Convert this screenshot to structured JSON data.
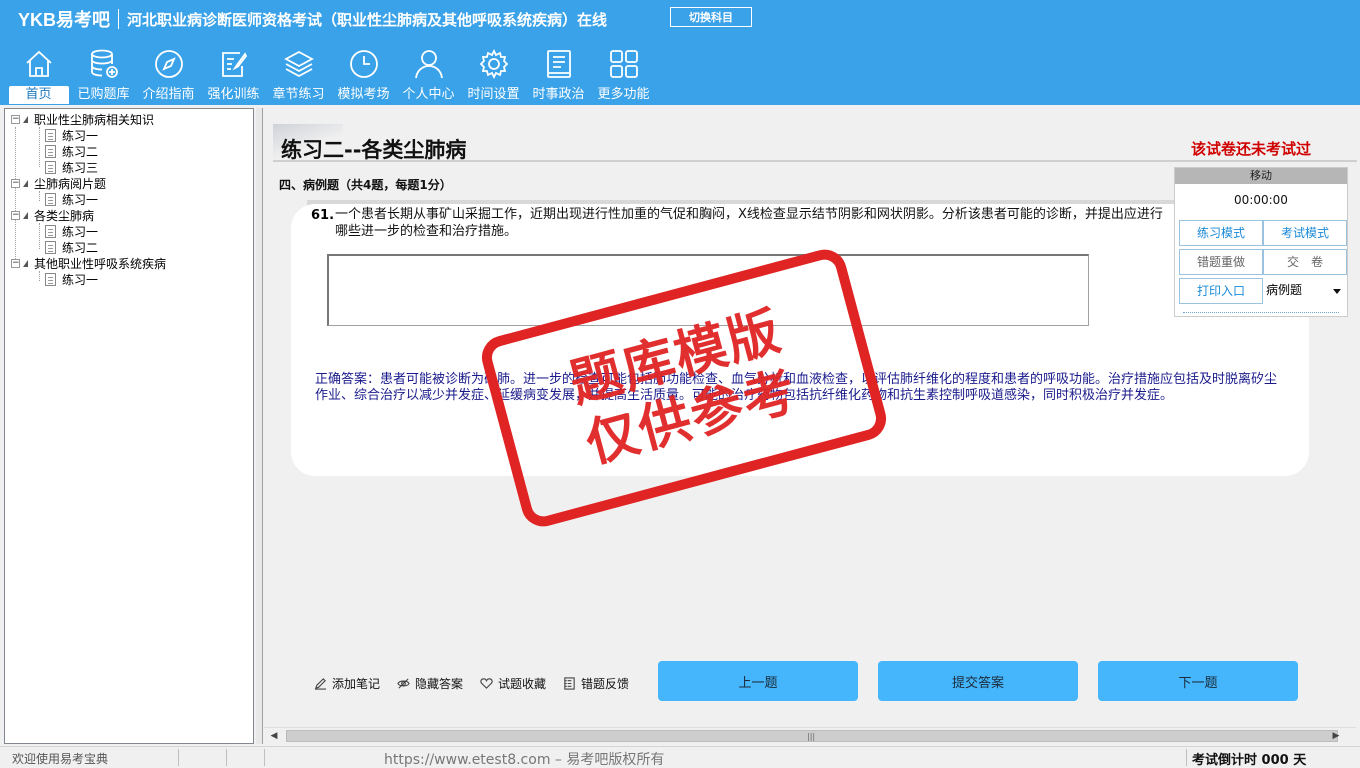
{
  "header": {
    "logo": "YKB易考吧",
    "title": "河北职业病诊断医师资格考试（职业性尘肺病及其他呼吸系统疾病）在线",
    "switch_label": "切换科目",
    "nav": [
      {
        "label": "首页",
        "icon": "home-icon",
        "active": true
      },
      {
        "label": "已购题库",
        "icon": "database-icon"
      },
      {
        "label": "介绍指南",
        "icon": "compass-icon"
      },
      {
        "label": "强化训练",
        "icon": "edit-icon"
      },
      {
        "label": "章节练习",
        "icon": "layers-icon"
      },
      {
        "label": "模拟考场",
        "icon": "clock-icon"
      },
      {
        "label": "个人中心",
        "icon": "user-icon"
      },
      {
        "label": "时间设置",
        "icon": "gear-icon"
      },
      {
        "label": "时事政治",
        "icon": "book-icon"
      },
      {
        "label": "更多功能",
        "icon": "grid-icon"
      }
    ]
  },
  "tree": [
    {
      "label": "职业性尘肺病相关知识",
      "children": [
        "练习一",
        "练习二",
        "练习三"
      ]
    },
    {
      "label": "尘肺病阅片题",
      "children": [
        "练习一"
      ]
    },
    {
      "label": "各类尘肺病",
      "children": [
        "练习一",
        "练习二"
      ]
    },
    {
      "label": "其他职业性呼吸系统疾病",
      "children": [
        "练习一"
      ]
    }
  ],
  "main": {
    "exercise_title": "练习二--各类尘肺病",
    "exam_status": "该试卷还未考试过",
    "section_title": "四、病例题（共4题，每题1分）",
    "question": {
      "number": "61.",
      "text": "一个患者长期从事矿山采掘工作，近期出现进行性加重的气促和胸闷，X线检查显示结节阴影和网状阴影。分析该患者可能的诊断，并提出应进行哪些进一步的检查和治疗措施。",
      "answer_value": ""
    },
    "correct_answer": "正确答案：患者可能被诊断为矽肺。进一步的检查可能包括肺功能检查、血气分析和血液检查，以评估肺纤维化的程度和患者的呼吸功能。治疗措施应包括及时脱离矽尘作业、综合治疗以减少并发症、延缓病变发展，并提高生活质量。可能的治疗药物包括抗纤维化药物和抗生素控制呼吸道感染，同时积极治疗并发症。"
  },
  "control_panel": {
    "move_label": "移动",
    "timer": "00:00:00",
    "practice_mode": "练习模式",
    "exam_mode": "考试模式",
    "redo_wrong": "错题重做",
    "submit_paper": "交　卷",
    "print_entry": "打印入口",
    "type_select": "病例题"
  },
  "actions": {
    "add_note": "添加笔记",
    "hide_answer": "隐藏答案",
    "favorite": "试题收藏",
    "feedback": "错题反馈",
    "prev": "上一题",
    "submit": "提交答案",
    "next": "下一题"
  },
  "statusbar": {
    "welcome": "欢迎使用易考宝典",
    "copyright": "https://www.etest8.com – 易考吧版权所有",
    "countdown": "考试倒计时 000 天"
  },
  "watermark": {
    "line1": "题库模版",
    "line2": "仅供参考"
  },
  "colors": {
    "header_bg": "#3aa2e8",
    "status_red": "#d00000",
    "answer_blue": "#1a1a8c",
    "button_blue": "#45b6fb",
    "watermark_red": "#e02424"
  }
}
